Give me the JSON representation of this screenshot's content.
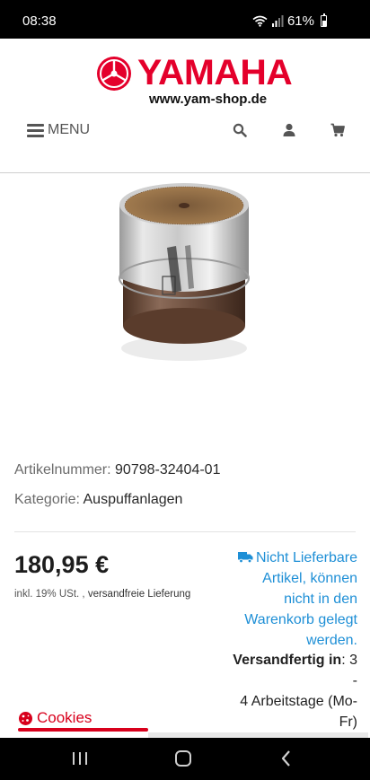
{
  "status_bar": {
    "time": "08:38",
    "battery": "61%"
  },
  "header": {
    "logo_text": "YAMAHA",
    "logo_url": "www.yam-shop.de",
    "menu_label": "MENU",
    "icons": [
      "search-icon",
      "user-icon",
      "cart-icon"
    ]
  },
  "product": {
    "article_label": "Artikelnummer:",
    "article_number": "90798-32404-01",
    "category_label": "Kategorie:",
    "category": "Auspuffanlagen",
    "price": "180,95 €",
    "tax_note": "inkl. 19% USt. ,",
    "shipping_note": "versandfreie Lieferung",
    "availability_lines": [
      "Nicht Lieferbare",
      "Artikel, können",
      "nicht in den",
      "Warenkorb gelegt",
      "werden."
    ],
    "ship_label": "Versandfertig in",
    "ship_lines": [
      ": 3 -",
      "4 Arbeitstage (Mo-",
      "Fr)"
    ]
  },
  "cookies": {
    "label": "Cookies"
  },
  "colors": {
    "brand_red": "#e4002b",
    "link_blue": "#1e8fd6"
  }
}
